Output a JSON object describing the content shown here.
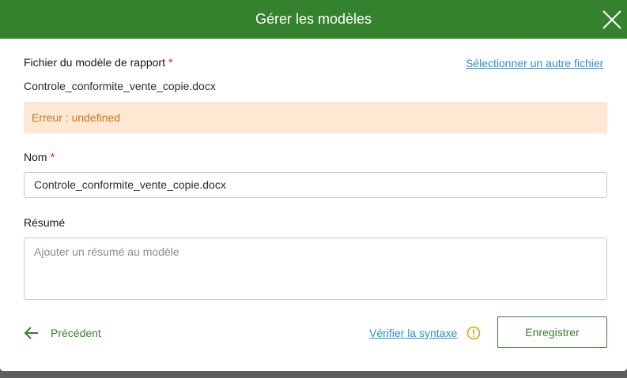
{
  "dialog": {
    "title": "Gérer les modèles",
    "close_icon": "close-icon"
  },
  "template_file": {
    "label": "Fichier du modèle de rapport",
    "required_mark": "*",
    "select_other_link": "Sélectionner un autre fichier",
    "file_name": "Controle_conformite_vente_copie.docx"
  },
  "error": {
    "text": "Erreur : undefined"
  },
  "name_field": {
    "label": "Nom",
    "required_mark": "*",
    "value": "Controle_conformite_vente_copie.docx"
  },
  "summary_field": {
    "label": "Résumé",
    "placeholder": "Ajouter un résumé au modèle"
  },
  "footer": {
    "previous_label": "Précédent",
    "verify_syntax_link": "Vérifier la syntaxe",
    "warning_icon": "warning-icon",
    "save_label": "Enregistrer"
  },
  "colors": {
    "header": "#35822e",
    "accent": "#35822e",
    "link": "#2b8fd1",
    "error_bg": "#fde8d3",
    "error_text": "#c9781e",
    "required": "#d83020",
    "warning": "#e0a000"
  }
}
